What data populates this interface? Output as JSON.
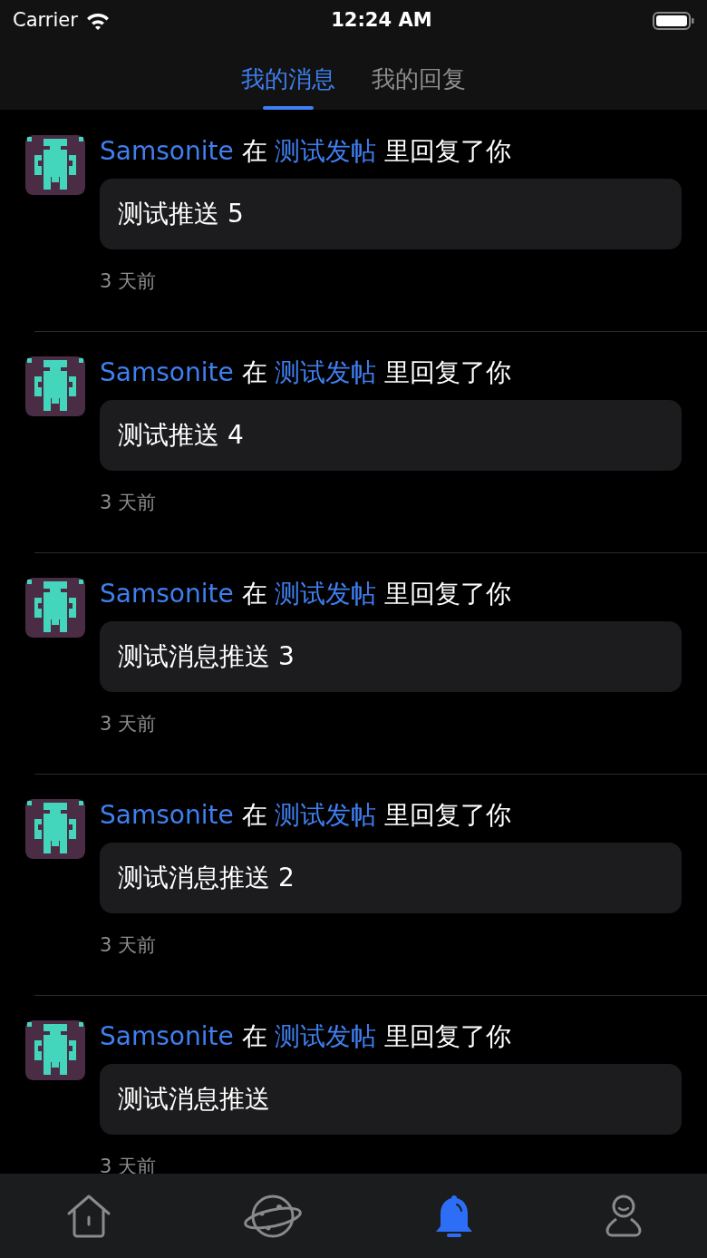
{
  "status_bar": {
    "carrier": "Carrier",
    "time": "12:24 AM"
  },
  "tabs": [
    {
      "label": "我的消息",
      "selected": true
    },
    {
      "label": "我的回复",
      "selected": false
    }
  ],
  "notifications": [
    {
      "user": "Samsonite",
      "connector": "在",
      "post": "测试发帖",
      "action": "里回复了你",
      "message": "测试推送 5",
      "time": "3 天前"
    },
    {
      "user": "Samsonite",
      "connector": "在",
      "post": "测试发帖",
      "action": "里回复了你",
      "message": "测试推送 4",
      "time": "3 天前"
    },
    {
      "user": "Samsonite",
      "connector": "在",
      "post": "测试发帖",
      "action": "里回复了你",
      "message": "测试消息推送 3",
      "time": "3 天前"
    },
    {
      "user": "Samsonite",
      "connector": "在",
      "post": "测试发帖",
      "action": "里回复了你",
      "message": "测试消息推送 2",
      "time": "3 天前"
    },
    {
      "user": "Samsonite",
      "connector": "在",
      "post": "测试发帖",
      "action": "里回复了你",
      "message": "测试消息推送",
      "time": "3 天前"
    }
  ],
  "tab_bar": [
    {
      "kind": "home",
      "selected": false
    },
    {
      "kind": "planet",
      "selected": false
    },
    {
      "kind": "bell",
      "selected": true
    },
    {
      "kind": "profile",
      "selected": false
    }
  ]
}
